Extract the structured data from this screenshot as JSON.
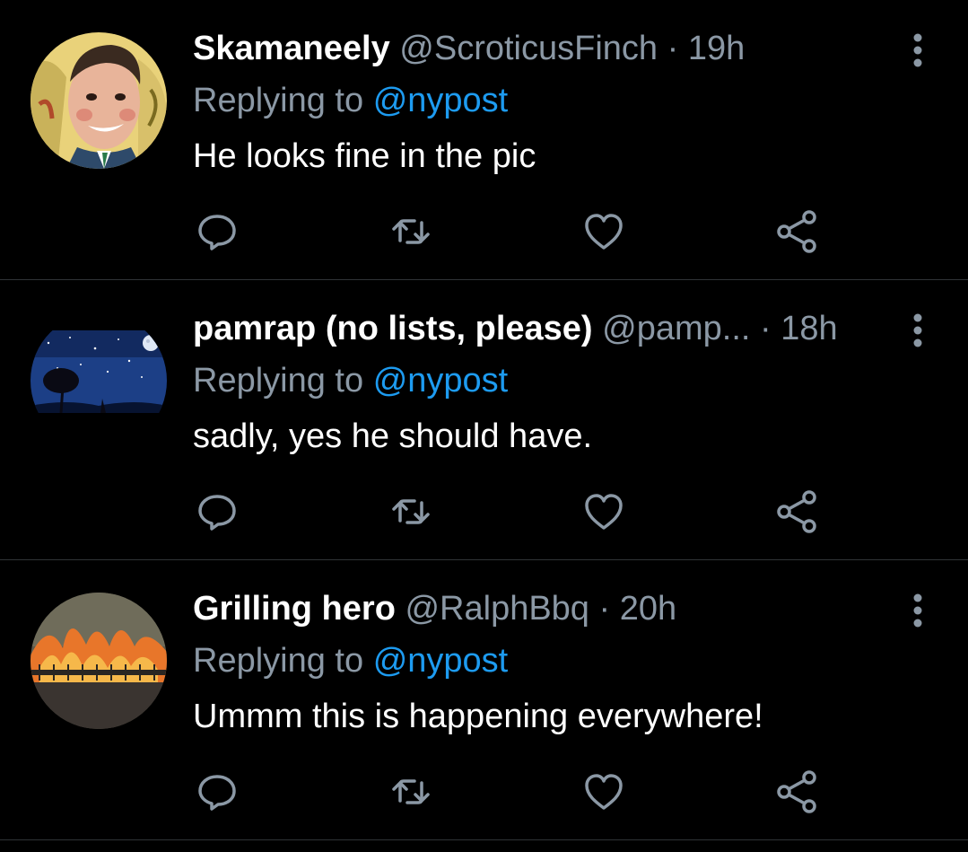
{
  "replies": [
    {
      "display_name": "Skamaneely",
      "handle": "@ScroticusFinch",
      "separator": "·",
      "time": "19h",
      "replying_prefix": "Replying to",
      "replying_to": "@nypost",
      "text": "He looks fine in the pic",
      "avatar_icon": "illustrated-man-avatar"
    },
    {
      "display_name": "pamrap (no lists, please)",
      "handle": "@pamp...",
      "separator": "·",
      "time": "18h",
      "replying_prefix": "Replying to",
      "replying_to": "@nypost",
      "text": "sadly, yes he should have.",
      "avatar_icon": "night-sky-avatar"
    },
    {
      "display_name": "Grilling hero",
      "handle": "@RalphBbq",
      "separator": "·",
      "time": "20h",
      "replying_prefix": "Replying to",
      "replying_to": "@nypost",
      "text": "Ummm this is happening everywhere!",
      "avatar_icon": "grill-fire-avatar"
    }
  ],
  "action_icons": [
    "reply-icon",
    "retweet-icon",
    "like-icon",
    "share-icon"
  ],
  "colors": {
    "background": "#000000",
    "text": "#ffffff",
    "secondary_text": "#8b98a5",
    "link": "#1d9bf0",
    "divider": "#2f3336"
  }
}
